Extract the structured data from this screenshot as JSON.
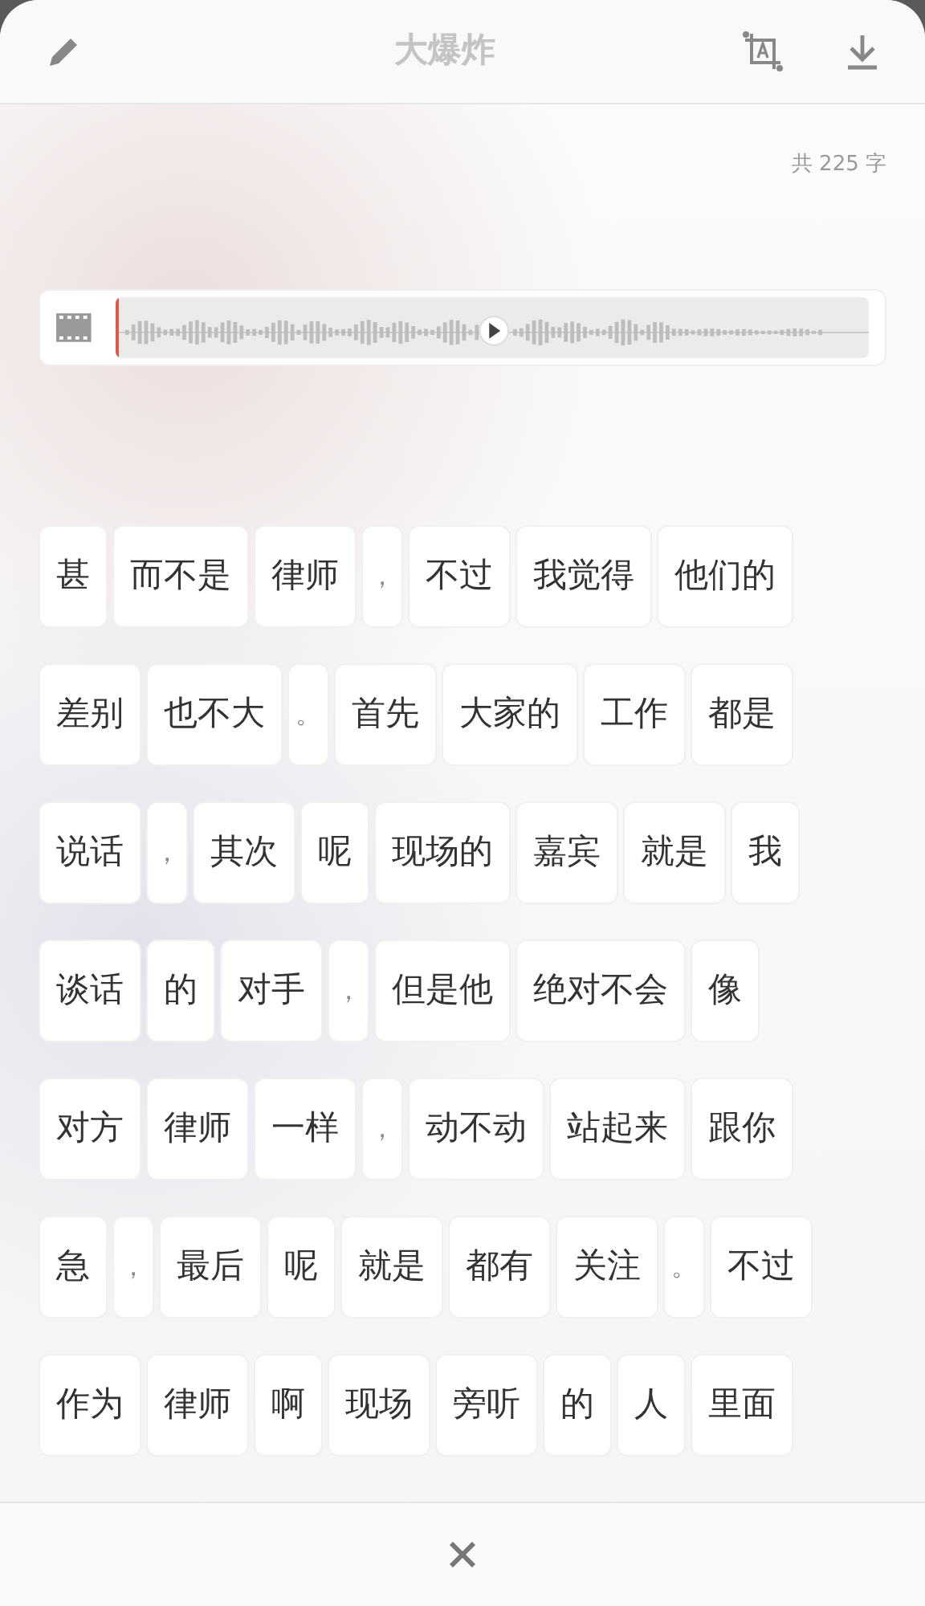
{
  "header": {
    "title": "大爆炸"
  },
  "count": "共 225 字",
  "audio": {
    "kind": "waveform"
  },
  "rows": [
    [
      {
        "text": "甚",
        "kind": "word"
      },
      {
        "text": "而不是",
        "kind": "word"
      },
      {
        "text": "律师",
        "kind": "word"
      },
      {
        "text": "，",
        "kind": "punct"
      },
      {
        "text": "不过",
        "kind": "word"
      },
      {
        "text": "我觉得",
        "kind": "word"
      },
      {
        "text": "他们的",
        "kind": "word"
      }
    ],
    [
      {
        "text": "差别",
        "kind": "word"
      },
      {
        "text": "也不大",
        "kind": "word"
      },
      {
        "text": "。",
        "kind": "punct"
      },
      {
        "text": "首先",
        "kind": "word"
      },
      {
        "text": "大家的",
        "kind": "word"
      },
      {
        "text": "工作",
        "kind": "word"
      },
      {
        "text": "都是",
        "kind": "word"
      }
    ],
    [
      {
        "text": "说话",
        "kind": "word"
      },
      {
        "text": "，",
        "kind": "punct"
      },
      {
        "text": "其次",
        "kind": "word"
      },
      {
        "text": "呢",
        "kind": "word"
      },
      {
        "text": "现场的",
        "kind": "word"
      },
      {
        "text": "嘉宾",
        "kind": "word"
      },
      {
        "text": "就是",
        "kind": "word"
      },
      {
        "text": "我",
        "kind": "word"
      }
    ],
    [
      {
        "text": "谈话",
        "kind": "word"
      },
      {
        "text": "的",
        "kind": "word"
      },
      {
        "text": "对手",
        "kind": "word"
      },
      {
        "text": "，",
        "kind": "punct"
      },
      {
        "text": "但是他",
        "kind": "word"
      },
      {
        "text": "绝对不会",
        "kind": "word"
      },
      {
        "text": "像",
        "kind": "word"
      }
    ],
    [
      {
        "text": "对方",
        "kind": "word"
      },
      {
        "text": "律师",
        "kind": "word"
      },
      {
        "text": "一样",
        "kind": "word"
      },
      {
        "text": "，",
        "kind": "punct"
      },
      {
        "text": "动不动",
        "kind": "word"
      },
      {
        "text": "站起来",
        "kind": "word"
      },
      {
        "text": "跟你",
        "kind": "word"
      }
    ],
    [
      {
        "text": "急",
        "kind": "word"
      },
      {
        "text": "，",
        "kind": "punct"
      },
      {
        "text": "最后",
        "kind": "word"
      },
      {
        "text": "呢",
        "kind": "word"
      },
      {
        "text": "就是",
        "kind": "word"
      },
      {
        "text": "都有",
        "kind": "word"
      },
      {
        "text": "关注",
        "kind": "word"
      },
      {
        "text": "。",
        "kind": "punct"
      },
      {
        "text": "不过",
        "kind": "word"
      }
    ],
    [
      {
        "text": "作为",
        "kind": "word"
      },
      {
        "text": "律师",
        "kind": "word"
      },
      {
        "text": "啊",
        "kind": "word"
      },
      {
        "text": "现场",
        "kind": "word"
      },
      {
        "text": "旁听",
        "kind": "word"
      },
      {
        "text": "的",
        "kind": "word"
      },
      {
        "text": "人",
        "kind": "word"
      },
      {
        "text": "里面",
        "kind": "word"
      }
    ]
  ]
}
